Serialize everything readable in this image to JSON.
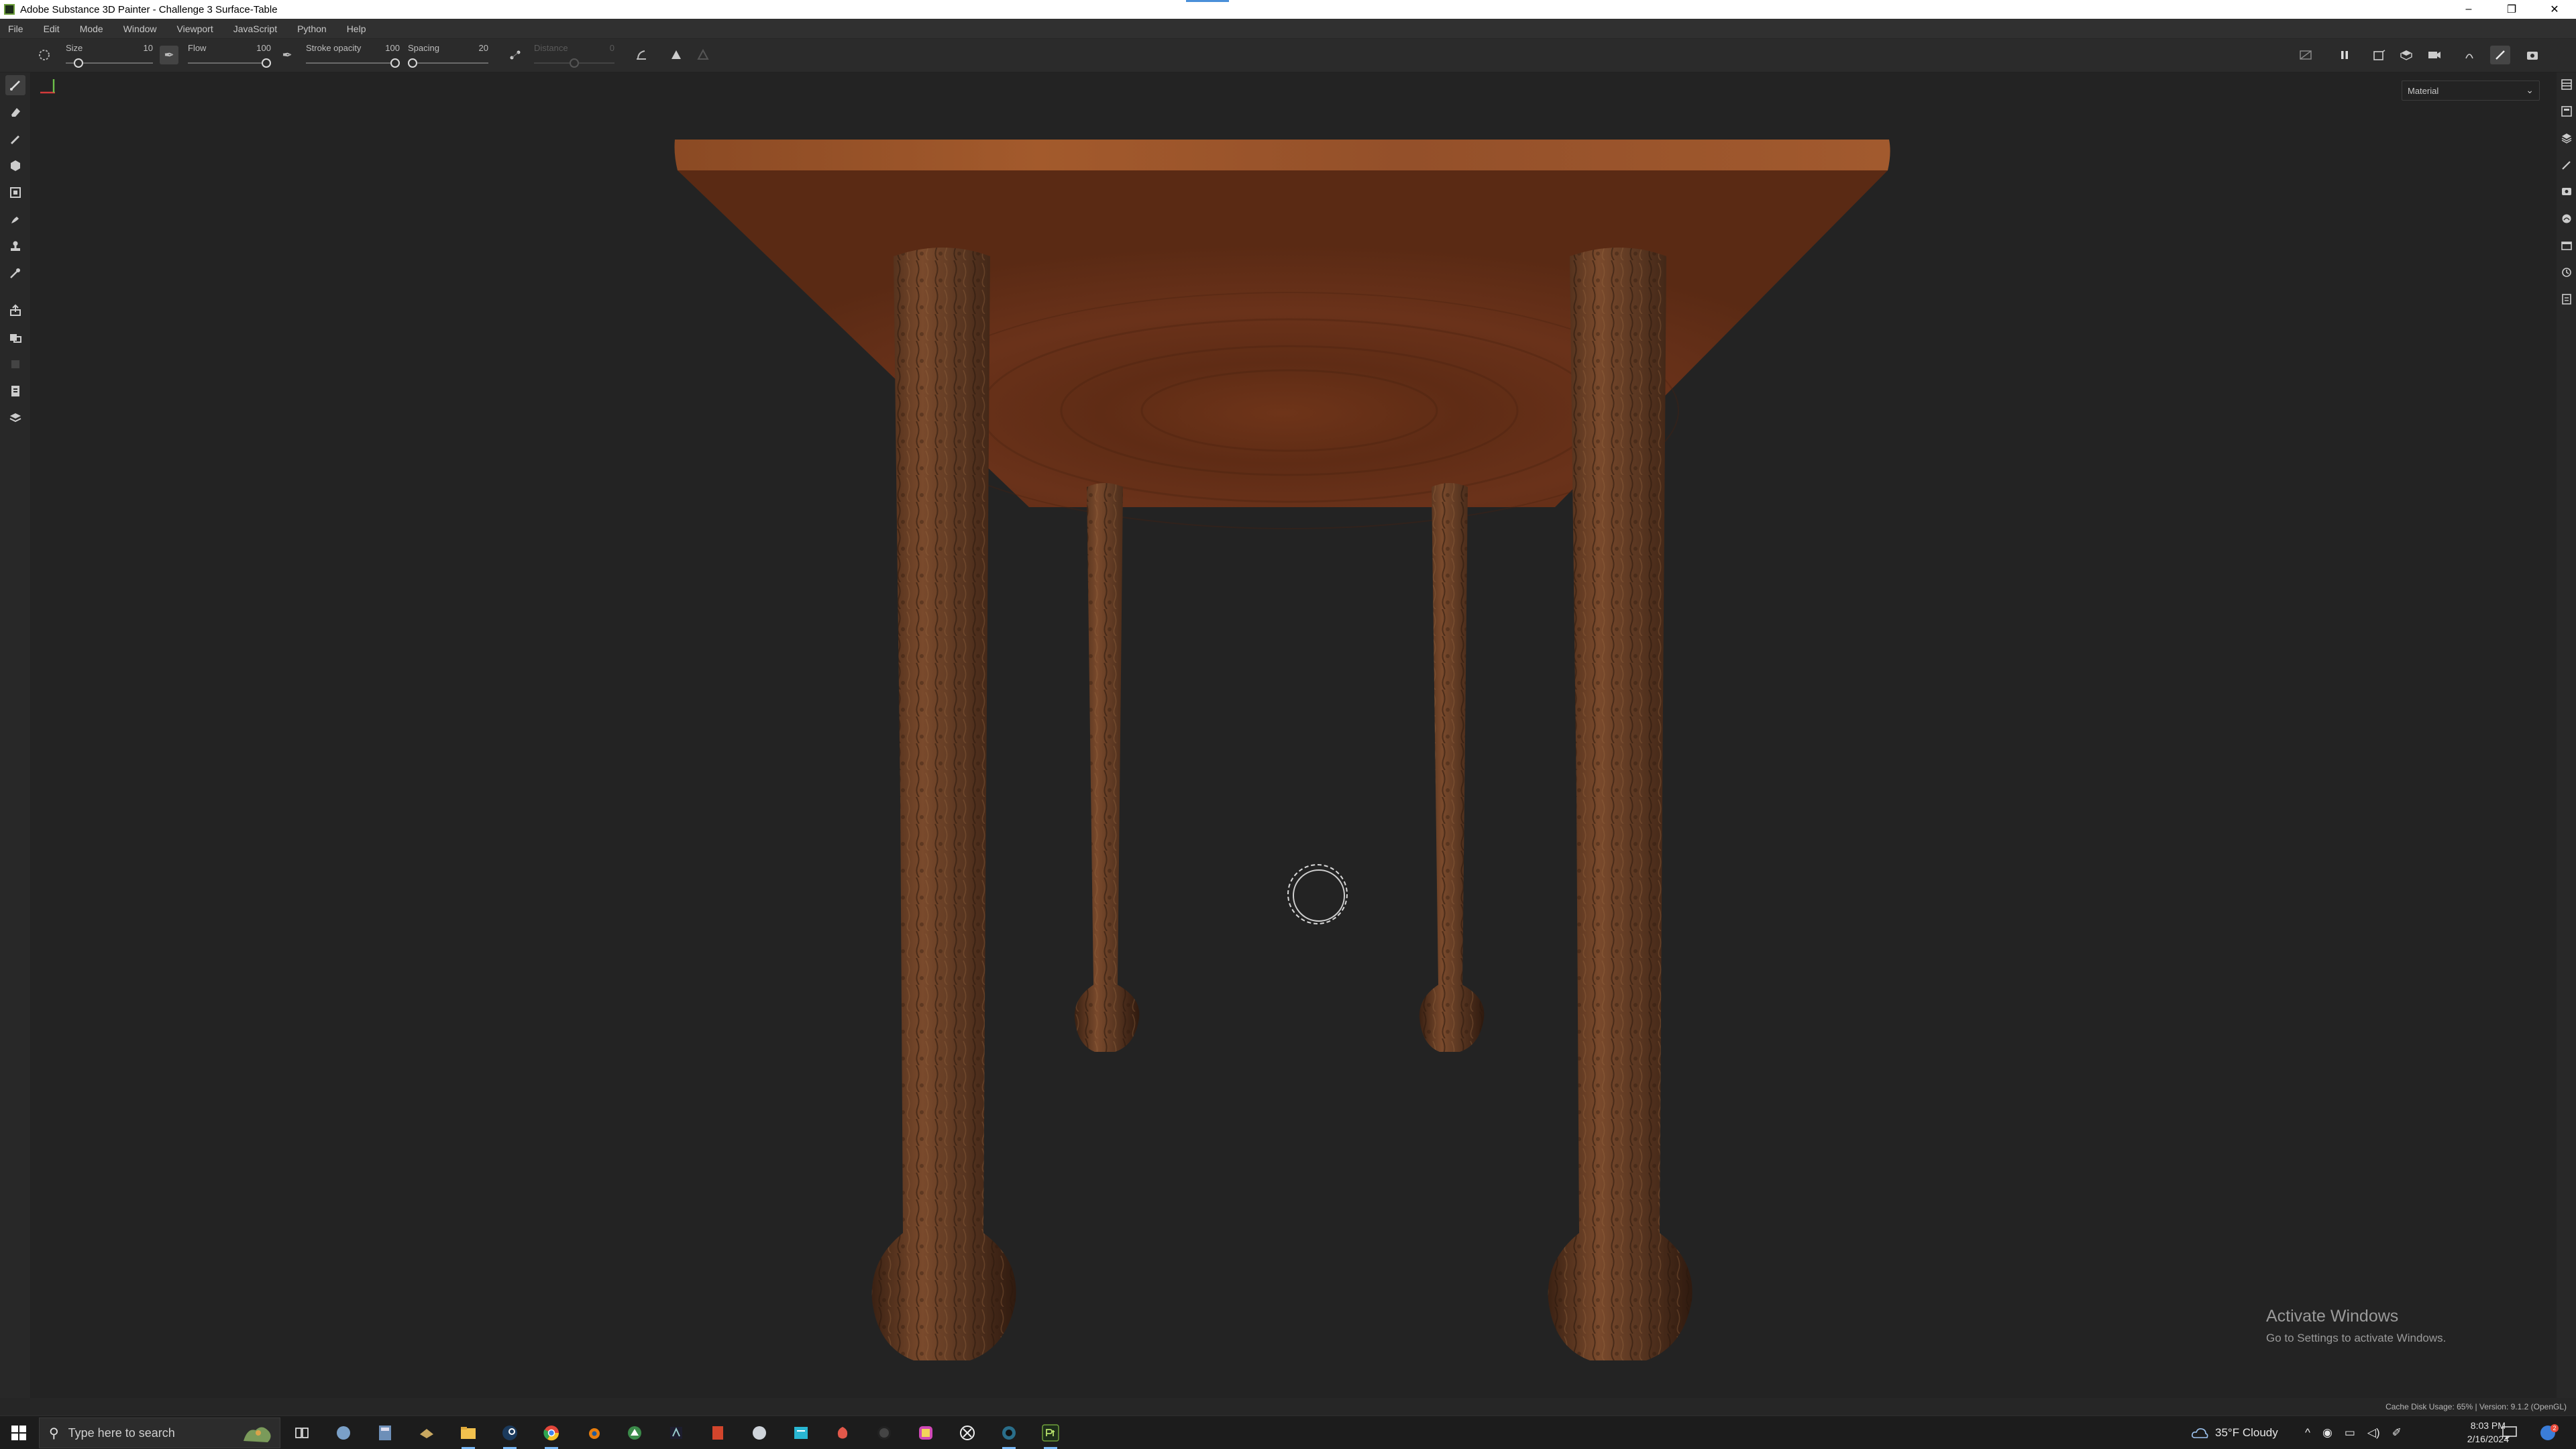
{
  "window": {
    "title": "Adobe Substance 3D Painter - Challenge 3 Surface-Table",
    "minimize": "–",
    "maximize": "❐",
    "close": "✕"
  },
  "menu": [
    "File",
    "Edit",
    "Mode",
    "Window",
    "Viewport",
    "JavaScript",
    "Python",
    "Help"
  ],
  "tool_options": {
    "size": {
      "label": "Size",
      "value": "10",
      "level": 0.1
    },
    "flow": {
      "label": "Flow",
      "value": "100",
      "level": 1.0
    },
    "stroke_opacity": {
      "label": "Stroke opacity",
      "value": "100",
      "level": 1.0
    },
    "spacing": {
      "label": "Spacing",
      "value": "20",
      "level": 0.0
    },
    "distance": {
      "label": "Distance",
      "value": "0",
      "level": 0.5,
      "disabled": true
    }
  },
  "viewport": {
    "channel_dropdown": "Material",
    "activate_title": "Activate Windows",
    "activate_sub": "Go to Settings to activate Windows."
  },
  "status": {
    "text": "Cache Disk Usage:  65% | Version: 9.1.2 (OpenGL)"
  },
  "taskbar": {
    "search_placeholder": "Type here to search",
    "weather": "35°F  Cloudy",
    "time": "8:03 PM",
    "date": "2/16/2024",
    "notification_count": "2"
  },
  "icons": {
    "brush": "✎",
    "eraser": "⌫",
    "projection": "◆",
    "geometry_fill": "⬢",
    "polygon_fill": "▣",
    "smudge": "✐",
    "clone": "⚲",
    "color_picker": "✒",
    "bake": "⬆",
    "settings": "⚙",
    "search": "⚲",
    "chevron_down": "⌄"
  },
  "colors": {
    "accent": "#4a90d9",
    "wood_top": "#7a3d20",
    "bark": "#6b3a1e"
  }
}
